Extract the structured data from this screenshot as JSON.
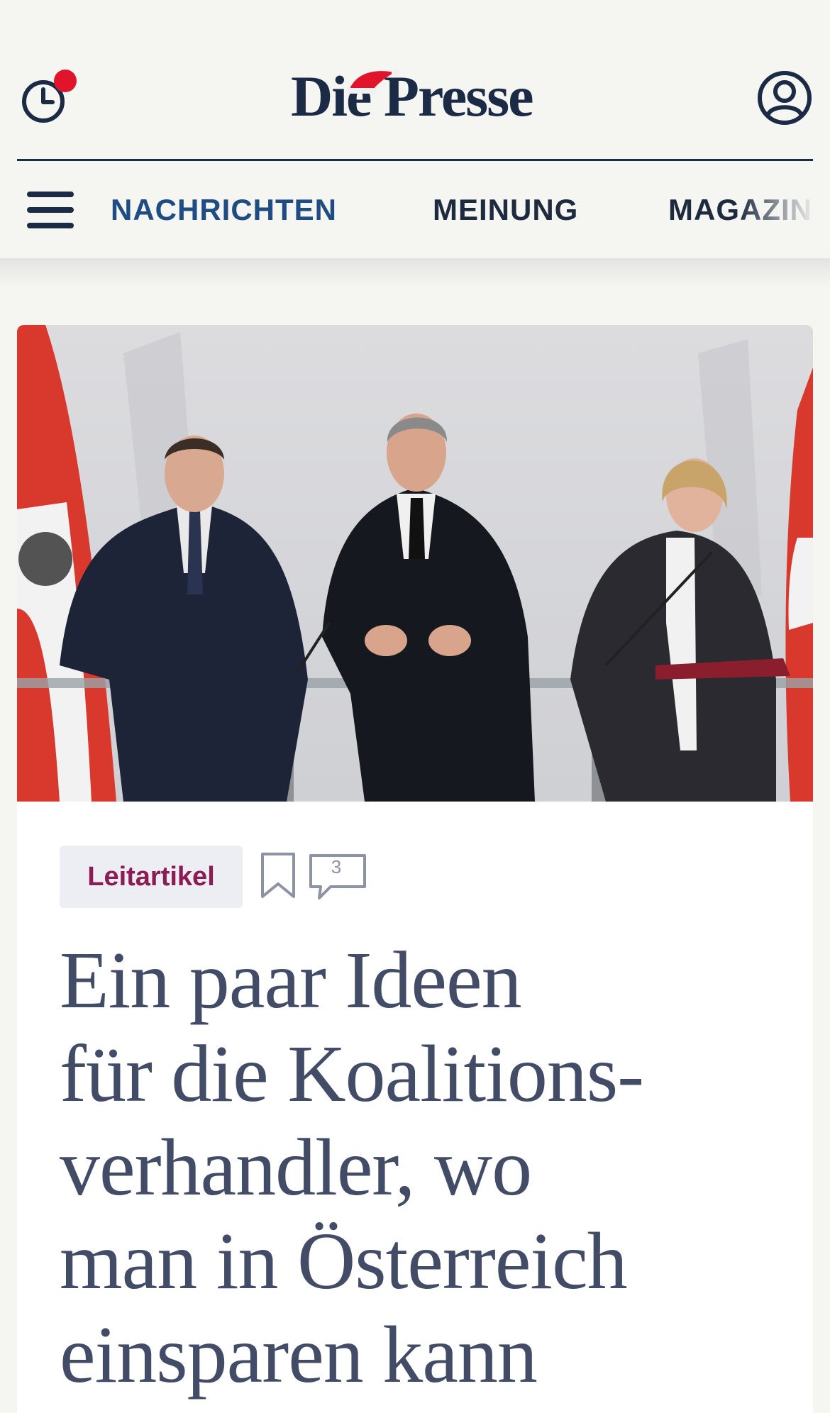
{
  "header": {
    "logo_text": "Die Presse",
    "history_icon": "history-clock-icon",
    "account_icon": "user-account-icon",
    "menu_icon": "hamburger-menu-icon",
    "notification_color": "#e0152c",
    "brand_color": "#1b2a45"
  },
  "nav": {
    "items": [
      {
        "label": "NACHRICHTEN",
        "active": true
      },
      {
        "label": "MEINUNG",
        "active": false
      },
      {
        "label": "MAGAZIN",
        "active": false
      }
    ],
    "active_color": "#1f4c82"
  },
  "article": {
    "image_description_icon": "hero-photo",
    "tag": "Leitartikel",
    "tag_color": "#8d1c55",
    "comment_count": "3",
    "headline_lines": [
      "Ein paar Ideen",
      "für die Koalitions-",
      "verhandler, wo",
      "man in Österreich",
      "einsparen kann"
    ]
  }
}
